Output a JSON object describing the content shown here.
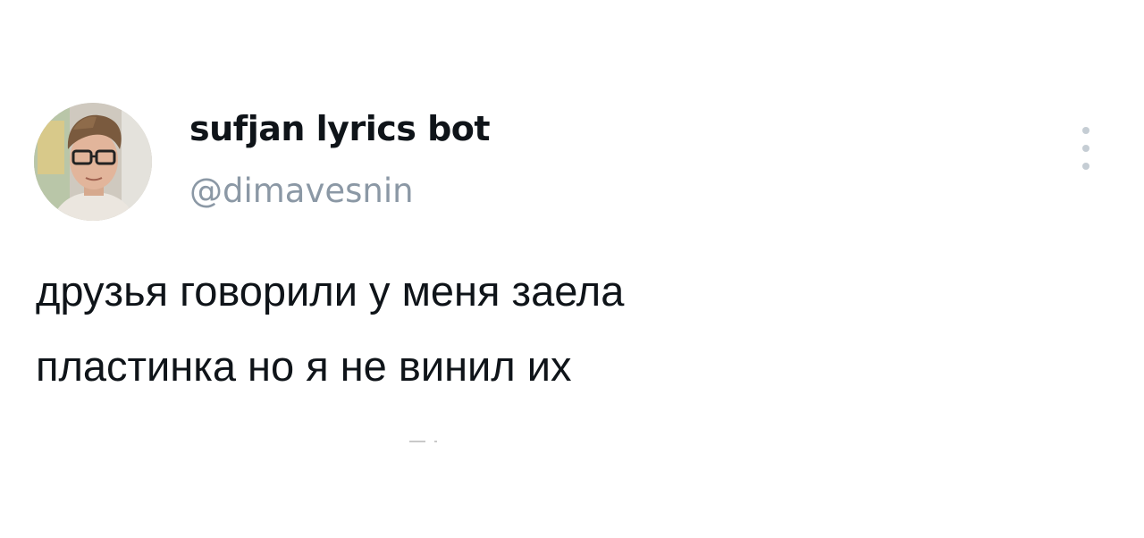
{
  "tweet": {
    "author": {
      "display_name": "sufjan lyrics bot",
      "handle": "@dimavesnin",
      "avatar_icon": "user-avatar-photo"
    },
    "text_lines": [
      "друзья говорили у меня заела",
      "пластинка но я не винил их"
    ],
    "menu_icon": "more-vertical-icon"
  },
  "colors": {
    "text": "#0f1419",
    "handle": "#8b98a5",
    "menu_dots": "#c5cdd4",
    "background": "#ffffff"
  }
}
